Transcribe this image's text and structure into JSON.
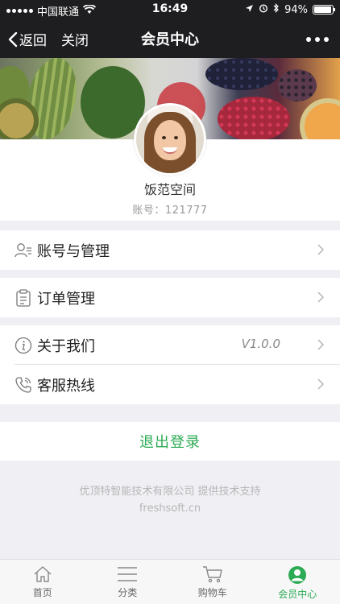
{
  "status_bar": {
    "carrier": "中国联通",
    "time": "16:49",
    "battery_percent": "94%",
    "battery_level": 0.94
  },
  "nav": {
    "back_label": "返回",
    "close_label": "关闭",
    "title": "会员中心"
  },
  "profile": {
    "name": "饭范空间",
    "account": "账号：121777"
  },
  "menu": {
    "group1": [
      {
        "label": "账号与管理",
        "icon": "user-manage-icon"
      }
    ],
    "group2": [
      {
        "label": "订单管理",
        "icon": "clipboard-icon"
      }
    ],
    "group3": [
      {
        "label": "关于我们",
        "icon": "info-icon",
        "value": "V1.0.0"
      },
      {
        "label": "客服热线",
        "icon": "phone-icon"
      }
    ]
  },
  "logout_label": "退出登录",
  "footer": {
    "support_text": "优顶特智能技术有限公司 提供技术支持",
    "website": "freshsoft.cn"
  },
  "tabbar": {
    "items": [
      {
        "label": "首页",
        "icon": "home-icon",
        "active": false
      },
      {
        "label": "分类",
        "icon": "menu-list-icon",
        "active": false
      },
      {
        "label": "购物车",
        "icon": "cart-icon",
        "active": false
      },
      {
        "label": "会员中心",
        "icon": "member-icon",
        "active": true
      }
    ]
  },
  "colors": {
    "accent": "#2cab54",
    "nav_background": "#1e1e20",
    "page_background": "#efeff4"
  }
}
